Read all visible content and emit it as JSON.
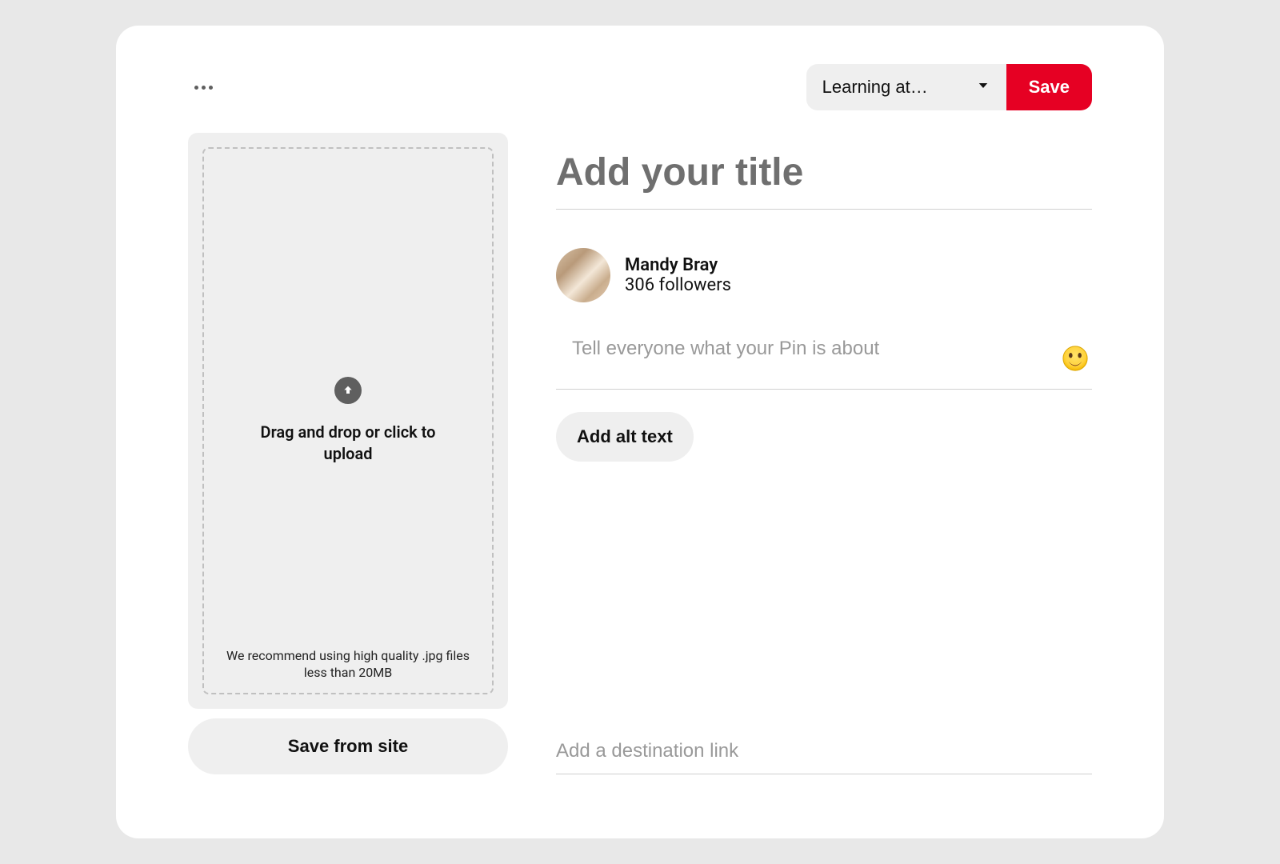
{
  "toolbar": {
    "board_selected_label": "Learning at…",
    "save_label": "Save"
  },
  "upload": {
    "main_text": "Drag and drop or click to upload",
    "hint_text": "We recommend using high quality .jpg files less than 20MB",
    "save_from_site_label": "Save from site"
  },
  "form": {
    "title_placeholder": "Add your title",
    "description_placeholder": "Tell everyone what your Pin is about",
    "alt_button_label": "Add alt text",
    "link_placeholder": "Add a destination link"
  },
  "author": {
    "name": "Mandy Bray",
    "followers_text": "306 followers"
  }
}
